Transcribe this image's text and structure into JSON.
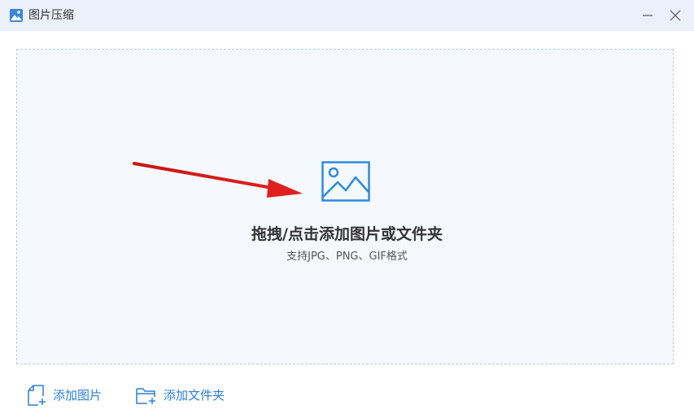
{
  "window": {
    "title": "图片压缩",
    "icons": {
      "app": "image-app-icon",
      "minimize": "minimize-icon",
      "close": "close-icon"
    }
  },
  "dropzone": {
    "icon": "image-icon",
    "main_text": "拖拽/点击添加图片或文件夹",
    "sub_text": "支持JPG、PNG、GIF格式"
  },
  "footer": {
    "add_image_label": "添加图片",
    "add_folder_label": "添加文件夹"
  },
  "colors": {
    "titlebar_bg": "#eaf1fb",
    "accent": "#2b7fd6",
    "dropzone_bg": "#f5f8fc",
    "dropzone_border": "#b9cde6",
    "arrow": "#d91c1c"
  }
}
